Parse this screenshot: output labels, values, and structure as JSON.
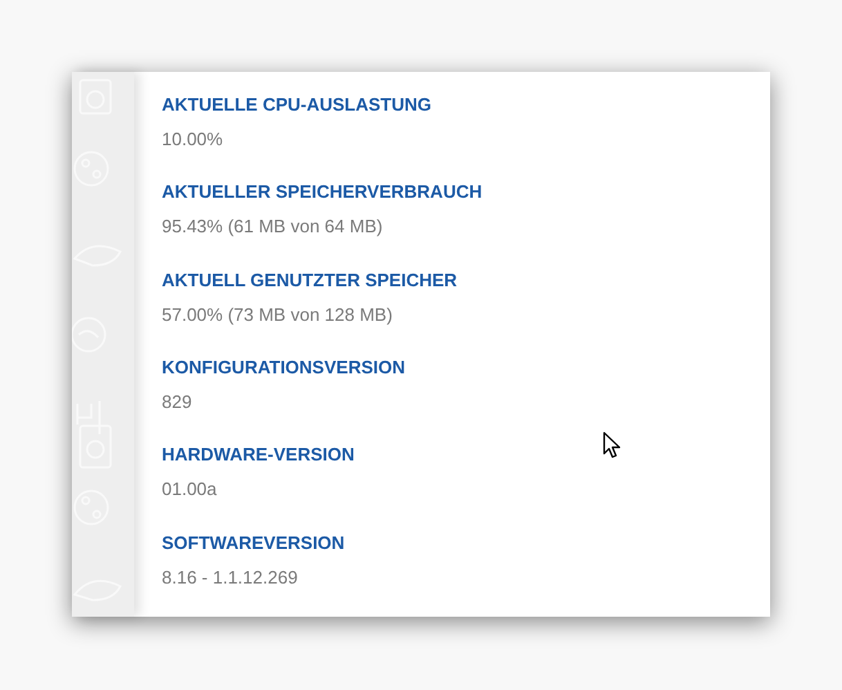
{
  "info_items": [
    {
      "label": "AKTUELLE CPU-AUSLASTUNG",
      "value": "10.00%"
    },
    {
      "label": "AKTUELLER SPEICHERVERBRAUCH",
      "value": "95.43% (61 MB von 64 MB)"
    },
    {
      "label": "AKTUELL GENUTZTER SPEICHER",
      "value": "57.00% (73 MB von 128 MB)"
    },
    {
      "label": "KONFIGURATIONSVERSION",
      "value": "829"
    },
    {
      "label": "HARDWARE-VERSION",
      "value": "01.00a"
    },
    {
      "label": "SOFTWAREVERSION",
      "value": "8.16 - 1.1.12.269"
    }
  ]
}
